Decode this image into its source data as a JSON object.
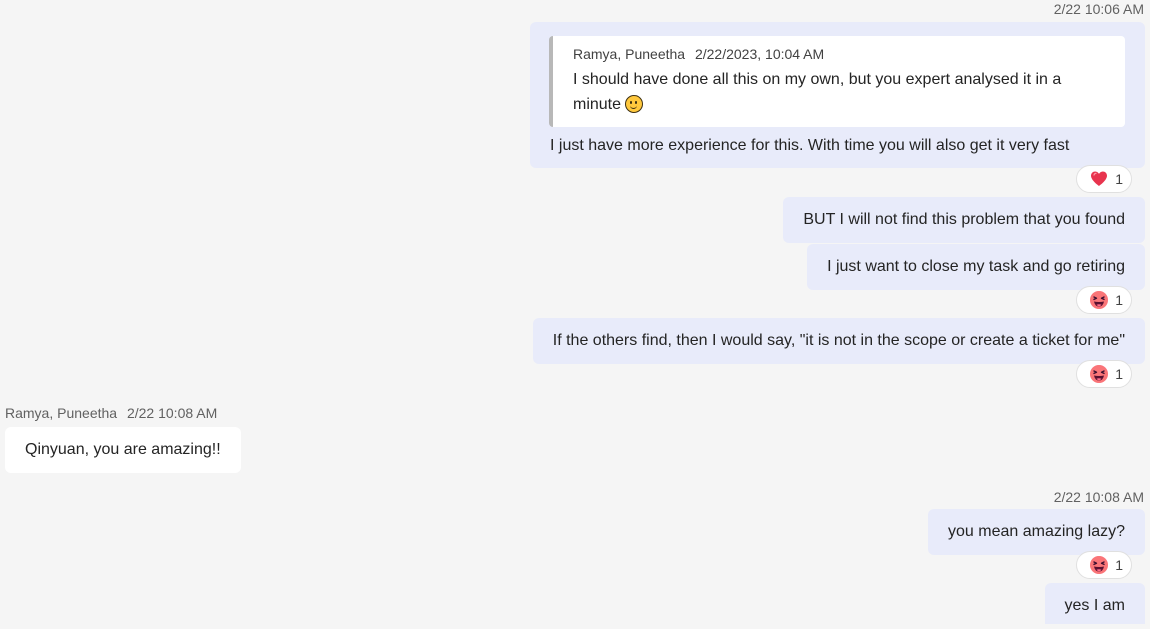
{
  "colors": {
    "background": "#f5f5f5",
    "outgoing_bubble": "#e8ebfa",
    "incoming_bubble": "#ffffff",
    "heart": "#e8344e",
    "laugh_face": "#ff5fa8"
  },
  "messages": {
    "group1_timestamp": "2/22 10:06 AM",
    "quote": {
      "author": "Ramya, Puneetha",
      "date": "2/22/2023, 10:04 AM",
      "text": "I should have done all this on my own, but you expert analysed it in a minute",
      "emoji": "slightly-smiling-face-icon"
    },
    "msg1": "I just have more experience for this. With time you will also get it very fast",
    "msg1_reaction": {
      "icon": "heart-icon",
      "count": "1"
    },
    "msg2": "BUT I will not find this problem that you found",
    "msg3": "I just want to close my task and go retiring",
    "msg3_reaction": {
      "icon": "laughing-face-icon",
      "count": "1"
    },
    "msg4": "If the others find, then I would say, \"it is not in the scope or create a ticket for me\"",
    "msg4_reaction": {
      "icon": "laughing-face-icon",
      "count": "1"
    },
    "incoming": {
      "sender": "Ramya, Puneetha",
      "time": "2/22 10:08 AM",
      "text": "Qinyuan, you are amazing!!"
    },
    "group2_timestamp": "2/22 10:08 AM",
    "msg5": "you mean amazing lazy?",
    "msg5_reaction": {
      "icon": "laughing-face-icon",
      "count": "1"
    },
    "msg6": "yes I am"
  }
}
